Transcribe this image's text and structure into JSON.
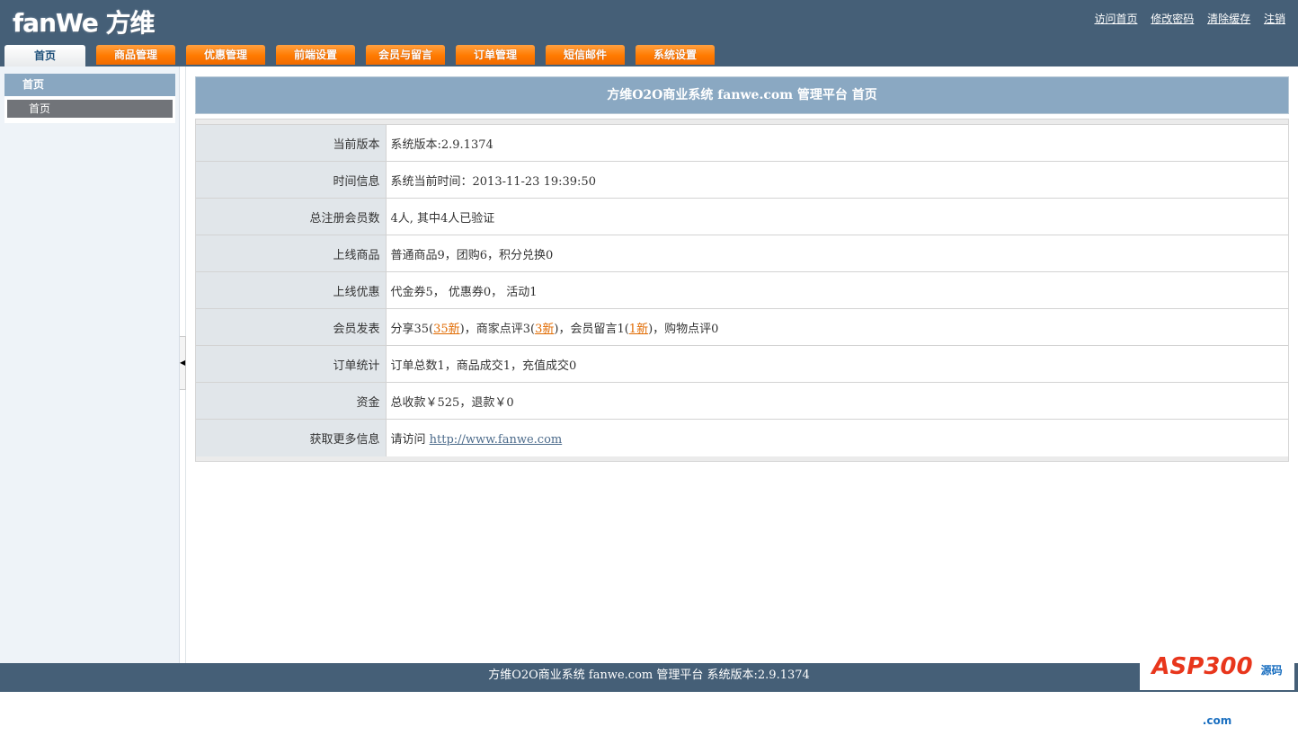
{
  "header": {
    "logo": "fanWe 方维",
    "links": [
      "访问首页",
      "修改密码",
      "清除缓存",
      "注销"
    ]
  },
  "tabs": [
    "首页",
    "商品管理",
    "优惠管理",
    "前端设置",
    "会员与留言",
    "订单管理",
    "短信邮件",
    "系统设置"
  ],
  "sidebar": {
    "heading": "首页",
    "item": "首页",
    "toggle_icon": "◀"
  },
  "main": {
    "title": "方维O2O商业系统 fanwe.com 管理平台 首页",
    "rows": [
      {
        "label": "当前版本",
        "value": "系统版本:2.9.1374"
      },
      {
        "label": "时间信息",
        "value": "系统当前时间：2013-11-23 19:39:50"
      },
      {
        "label": "总注册会员数",
        "value": "4人, 其中4人已验证"
      },
      {
        "label": "上线商品",
        "value": "普通商品9，团购6，积分兑换0"
      },
      {
        "label": "上线优惠",
        "value": "代金券5， 优惠券0， 活动1"
      },
      {
        "label": "会员发表",
        "parts": {
          "a": "分享35(",
          "a_new": "35新",
          "b": ")，商家点评3(",
          "b_new": "3新",
          "c": ")，会员留言1(",
          "c_new": "1新",
          "d": ")，购物点评0"
        }
      },
      {
        "label": "订单统计",
        "value": "订单总数1，商品成交1，充值成交0"
      },
      {
        "label": "资金",
        "value": "总收款￥525，退款￥0"
      },
      {
        "label": "获取更多信息",
        "value": "请访问 ",
        "link": "http://www.fanwe.com"
      }
    ]
  },
  "footer": {
    "text": "方维O2O商业系统 fanwe.com 管理平台 系统版本:2.9.1374",
    "watermark": "ASP300",
    "watermark_sub": "源码 .com"
  }
}
